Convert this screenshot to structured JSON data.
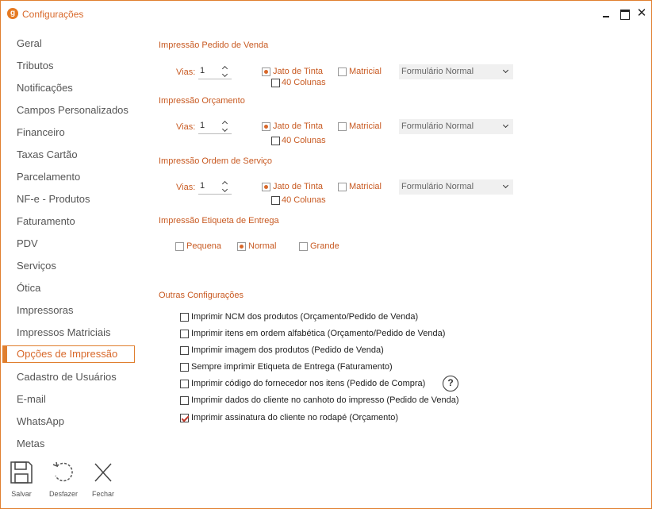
{
  "window": {
    "title": "Configurações",
    "logo_letter": "g",
    "close_glyph": "✕"
  },
  "sidebar": {
    "items": [
      {
        "label": "Geral"
      },
      {
        "label": "Tributos"
      },
      {
        "label": "Notificações"
      },
      {
        "label": "Campos Personalizados"
      },
      {
        "label": "Financeiro"
      },
      {
        "label": "Taxas Cartão"
      },
      {
        "label": "Parcelamento"
      },
      {
        "label": "NF-e - Produtos"
      },
      {
        "label": "Faturamento"
      },
      {
        "label": "PDV"
      },
      {
        "label": "Serviços"
      },
      {
        "label": "Ótica"
      },
      {
        "label": "Impressoras"
      },
      {
        "label": "Impressos Matriciais"
      },
      {
        "label": "Opções de Impressão"
      },
      {
        "label": "Cadastro de Usuários"
      },
      {
        "label": "E-mail"
      },
      {
        "label": "WhatsApp"
      },
      {
        "label": "Metas"
      }
    ],
    "active_index": 14
  },
  "footer": {
    "save": "Salvar",
    "undo": "Desfazer",
    "close": "Fechar"
  },
  "pedido": {
    "title": "Impressão Pedido de Venda",
    "vias_label": "Vias:",
    "vias_value": "1",
    "jato": "Jato de Tinta",
    "matricial": "Matricial",
    "colunas": "40 Colunas",
    "formulario": "Formulário Normal"
  },
  "orcamento": {
    "title": "Impressão Orçamento",
    "vias_label": "Vias:",
    "vias_value": "1",
    "jato": "Jato de Tinta",
    "matricial": "Matricial",
    "colunas": "40 Colunas",
    "formulario": "Formulário Normal"
  },
  "ordem": {
    "title": "Impressão Ordem de Serviço",
    "vias_label": "Vias:",
    "vias_value": "1",
    "jato": "Jato de Tinta",
    "matricial": "Matricial",
    "colunas": "40 Colunas",
    "formulario": "Formulário Normal"
  },
  "etiqueta": {
    "title": "Impressão Etiqueta de Entrega",
    "pequena": "Pequena",
    "normal": "Normal",
    "grande": "Grande"
  },
  "outras": {
    "title": "Outras Configurações",
    "options": [
      {
        "label": "Imprimir NCM dos produtos (Orçamento/Pedido de Venda)",
        "checked": false
      },
      {
        "label": "Imprimir itens em ordem alfabética (Orçamento/Pedido de Venda)",
        "checked": false
      },
      {
        "label": "Imprimir imagem dos produtos (Pedido de Venda)",
        "checked": false
      },
      {
        "label": "Sempre imprimir Etiqueta de Entrega (Faturamento)",
        "checked": false
      },
      {
        "label": "Imprimir código do fornecedor nos itens (Pedido de Compra)",
        "checked": false
      },
      {
        "label": "Imprimir dados do cliente no canhoto do impresso (Pedido de Venda)",
        "checked": false
      },
      {
        "label": "Imprimir assinatura do cliente no rodapé (Orçamento)",
        "checked": true
      }
    ],
    "help_glyph": "?"
  },
  "colors": {
    "accent": "#d8682a",
    "border": "#e07f2f",
    "check": "#c0392b"
  }
}
